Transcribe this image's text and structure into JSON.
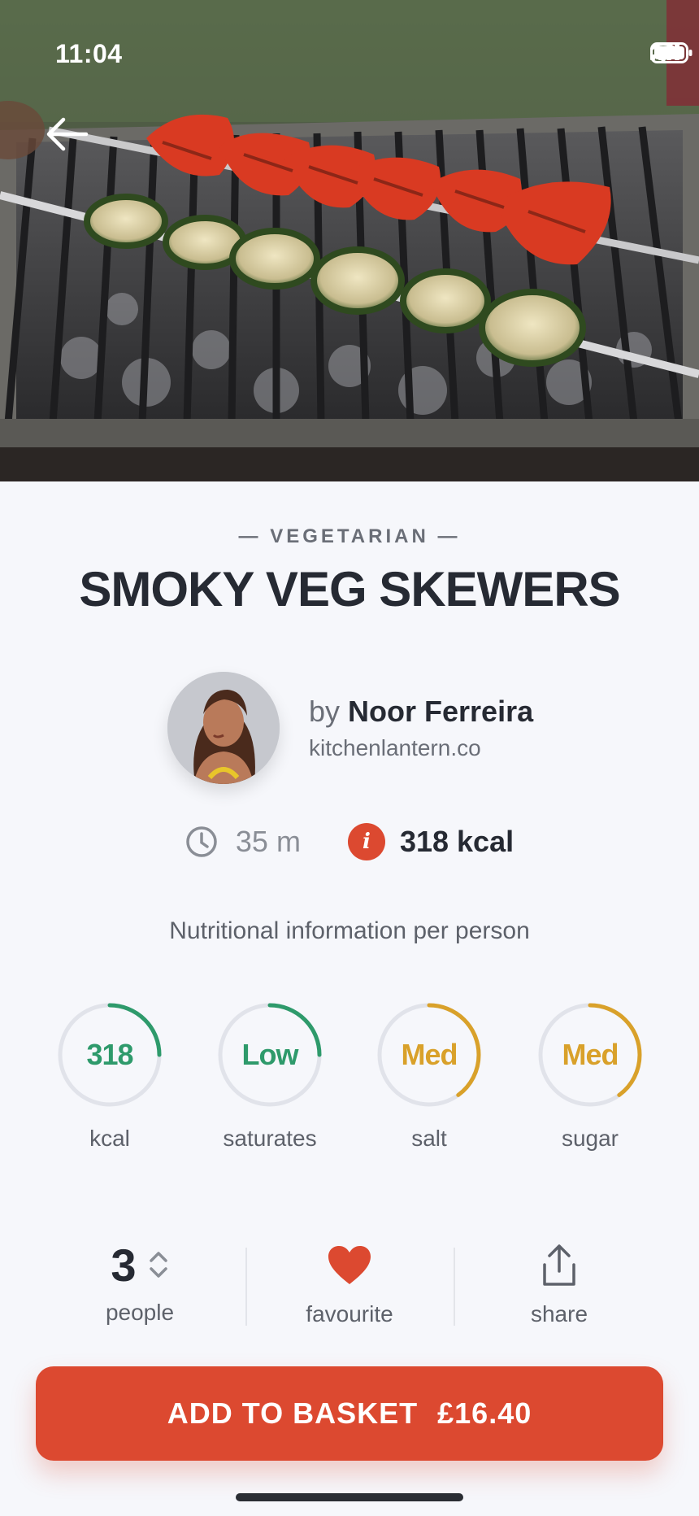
{
  "status_bar": {
    "time": "11:04"
  },
  "recipe": {
    "category": "— VEGETARIAN —",
    "title": "SMOKY VEG SKEWERS",
    "author_prefix": "by ",
    "author_name": "Noor Ferreira",
    "author_site": "kitchenlantern.co",
    "time": "35 m",
    "kcal": "318 kcal",
    "info_icon": "i"
  },
  "nutrition": {
    "heading": "Nutritional information per person",
    "items": [
      {
        "value": "318",
        "label": "kcal",
        "color": "#2e9a6b",
        "level": 0.25
      },
      {
        "value": "Low",
        "label": "saturates",
        "color": "#2e9a6b",
        "level": 0.25
      },
      {
        "value": "Med",
        "label": "salt",
        "color": "#d9a12a",
        "level": 0.4
      },
      {
        "value": "Med",
        "label": "sugar",
        "color": "#d9a12a",
        "level": 0.4
      }
    ]
  },
  "actions": {
    "people_count": "3",
    "people_label": "people",
    "favourite_label": "favourite",
    "share_label": "share"
  },
  "basket": {
    "label": "ADD TO BASKET",
    "price": "£16.40"
  },
  "colors": {
    "accent": "#dc4930",
    "good": "#2e9a6b",
    "medium": "#d9a12a",
    "text": "#262a33",
    "muted": "#6a6e77"
  },
  "icons": {
    "back": "arrow-left-icon",
    "clock": "clock-icon",
    "info": "info-icon",
    "stepper": "chevron-up-down-icon",
    "favourite": "heart-icon",
    "share": "share-icon"
  }
}
